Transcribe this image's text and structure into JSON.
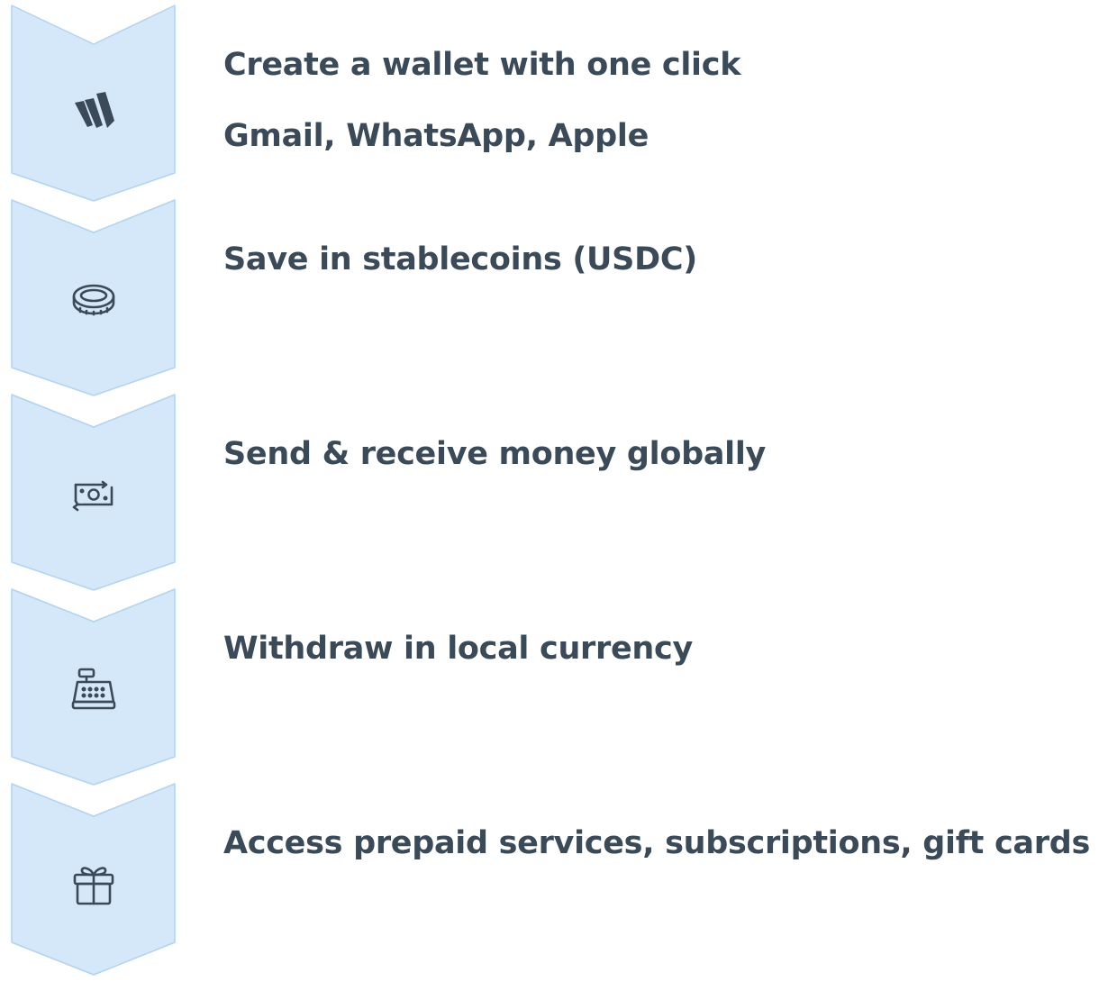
{
  "steps": [
    {
      "icon": "brand-logo-icon",
      "title": "Create a wallet with one click",
      "subtitle": "Gmail, WhatsApp, Apple"
    },
    {
      "icon": "coin-icon",
      "title": "Save in stablecoins (USDC)"
    },
    {
      "icon": "money-transfer-icon",
      "title": "Send & receive money globally"
    },
    {
      "icon": "cash-register-icon",
      "title": "Withdraw in local currency"
    },
    {
      "icon": "gift-icon",
      "title": "Access prepaid services, subscriptions, gift cards"
    }
  ],
  "colors": {
    "chevron_fill": "#d5e8f9",
    "chevron_stroke": "#b2d3ef",
    "text": "#3b4a58",
    "icon": "#3b4a58"
  }
}
